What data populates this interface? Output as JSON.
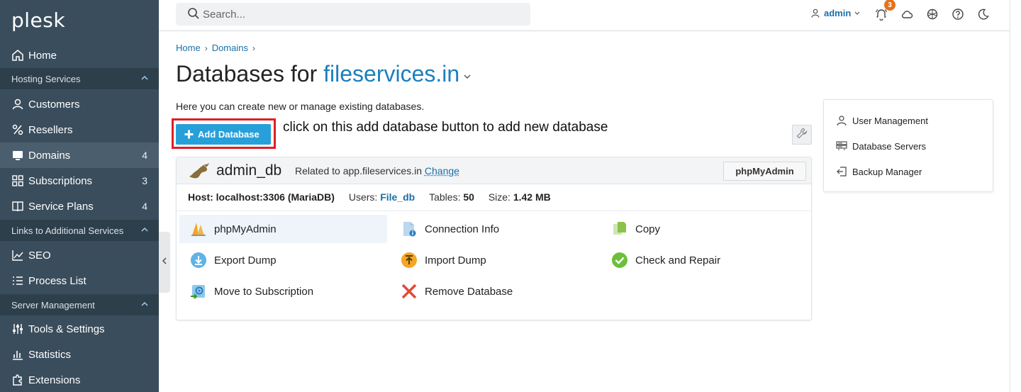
{
  "app": {
    "logo": "plesk"
  },
  "sidebar": {
    "items": [
      {
        "label": "Home",
        "icon": "home-icon"
      },
      {
        "label": "Customers",
        "icon": "user-icon"
      },
      {
        "label": "Resellers",
        "icon": "percent-icon"
      },
      {
        "label": "Domains",
        "icon": "monitor-icon",
        "count": "4",
        "active": true
      },
      {
        "label": "Subscriptions",
        "icon": "grid-icon",
        "count": "3"
      },
      {
        "label": "Service Plans",
        "icon": "book-icon",
        "count": "4"
      },
      {
        "label": "SEO",
        "icon": "chart-icon"
      },
      {
        "label": "Process List",
        "icon": "list-icon"
      },
      {
        "label": "Tools & Settings",
        "icon": "sliders-icon"
      },
      {
        "label": "Statistics",
        "icon": "bar-chart-icon"
      },
      {
        "label": "Extensions",
        "icon": "puzzle-icon"
      }
    ],
    "sections": [
      "Hosting Services",
      "Links to Additional Services",
      "Server Management"
    ]
  },
  "topbar": {
    "search_placeholder": "Search...",
    "user": "admin",
    "notifications_count": "3"
  },
  "breadcrumb": [
    "Home",
    "Domains"
  ],
  "page": {
    "title_prefix": "Databases for ",
    "title_domain": "fileservices.in",
    "description": "Here you can create new or manage existing databases.",
    "add_button": "Add Database",
    "annotation": "click on this add database button to add new database"
  },
  "database": {
    "name": "admin_db",
    "related_prefix": "Related to app.fileservices.in",
    "change_link": "Change",
    "phpmyadmin_button": "phpMyAdmin",
    "host_label": "Host:",
    "host_value": "localhost:3306 (MariaDB)",
    "users_label": "Users:",
    "users_value": "File_db",
    "tables_label": "Tables:",
    "tables_value": "50",
    "size_label": "Size:",
    "size_value": "1.42 MB",
    "actions": [
      "phpMyAdmin",
      "Connection Info",
      "Copy",
      "Export Dump",
      "Import Dump",
      "Check and Repair",
      "Move to Subscription",
      "Remove Database"
    ]
  },
  "side_panel": {
    "links": [
      "User Management",
      "Database Servers",
      "Backup Manager"
    ]
  },
  "colors": {
    "sidebar": "#3a4d5c",
    "accent": "#1b7fbf",
    "button": "#27a0da",
    "highlight": "#e01e25"
  }
}
